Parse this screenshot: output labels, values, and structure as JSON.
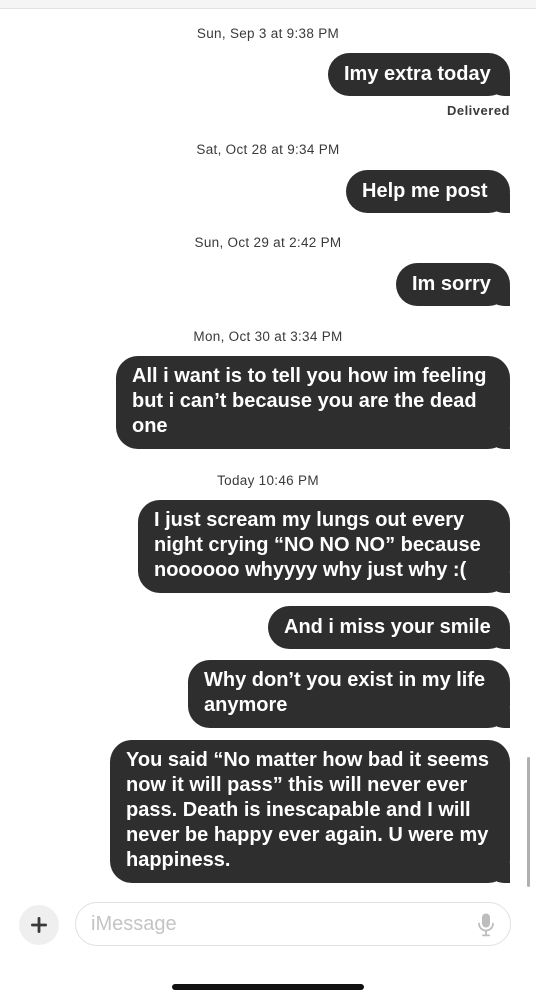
{
  "thread": {
    "groups": [
      {
        "timestamp": "Sun, Sep 3 at 9:38 PM",
        "messages": [
          "Imy extra today"
        ],
        "status": "Delivered"
      },
      {
        "timestamp": "Sat, Oct 28 at 9:34 PM",
        "messages": [
          "Help me post"
        ]
      },
      {
        "timestamp": "Sun, Oct 29 at 2:42 PM",
        "messages": [
          "Im sorry"
        ]
      },
      {
        "timestamp": "Mon, Oct 30 at 3:34 PM",
        "messages": [
          "All i want is to tell you how im feeling but i can’t because you are the dead one"
        ]
      },
      {
        "timestamp": "Today 10:46 PM",
        "messages": [
          "I just scream my lungs out every night crying “NO NO NO” because noooooo whyyyy why just why :(",
          "And i miss your smile",
          "Why don’t you exist in my life anymore",
          "You said “No matter how bad it seems now it will pass” this will never ever pass. Death is inescapable and I will never be happy ever again. U were my happiness."
        ]
      }
    ]
  },
  "composer": {
    "placeholder": "iMessage",
    "plus_icon": "plus-icon",
    "mic_icon": "microphone-icon"
  },
  "colors": {
    "bubble": "#2e2e2e",
    "bubble_text": "#ffffff",
    "background": "#ffffff",
    "placeholder": "#c4c4c4"
  }
}
